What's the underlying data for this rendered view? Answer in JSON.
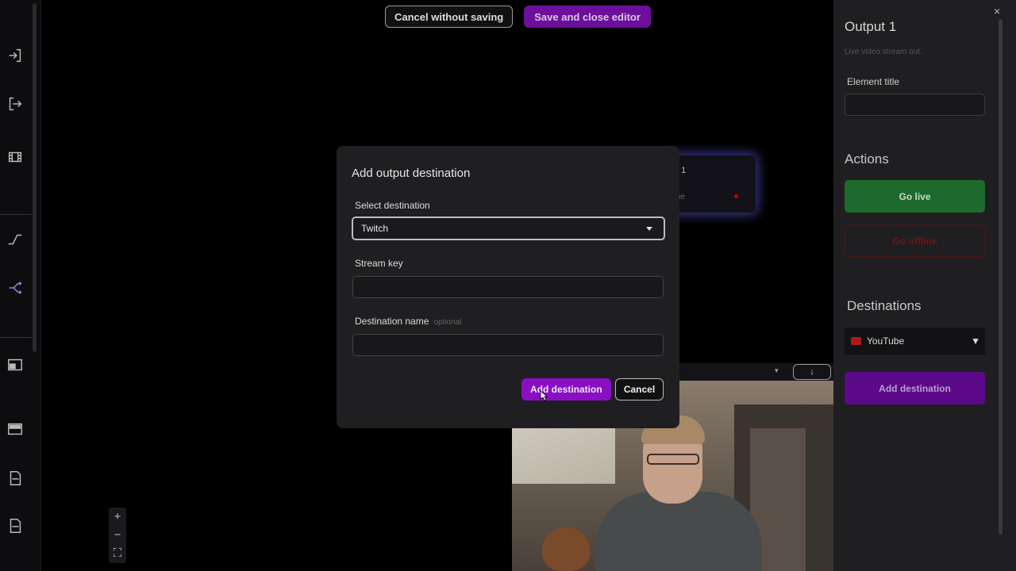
{
  "top_bar": {
    "cancel_label": "Cancel without saving",
    "save_label": "Save and close editor"
  },
  "node": {
    "title_fragment": "t 1",
    "subtitle_fragment": "be",
    "status_color": "#cc0000"
  },
  "zoom": {
    "in_label": "+",
    "out_label": "−",
    "fit_label": "⛶"
  },
  "video_bar": {
    "chevron": "▾",
    "download_label": "↓"
  },
  "modal": {
    "title": "Add output destination",
    "select_label": "Select destination",
    "select_value": "Twitch",
    "stream_key_label": "Stream key",
    "stream_key_value": "",
    "destination_name_label": "Destination name",
    "destination_name_hint": "optional",
    "destination_name_value": "",
    "add_label": "Add destination",
    "cancel_label": "Cancel"
  },
  "panel": {
    "close_label": "×",
    "title": "Output 1",
    "subtitle": "Live video stream out.",
    "element_title_label": "Element title",
    "element_title_value": "",
    "actions_heading": "Actions",
    "go_live_label": "Go live",
    "go_offline_label": "Go offline",
    "destinations_heading": "Destinations",
    "destinations": [
      {
        "name": "YouTube",
        "icon": "youtube-icon",
        "toggle": "▼"
      }
    ],
    "add_destination_label": "Add destination"
  },
  "colors": {
    "accent_purple": "#8a0fc4",
    "go_live_green": "#1e6a2c",
    "offline_red": "#6e1617"
  }
}
